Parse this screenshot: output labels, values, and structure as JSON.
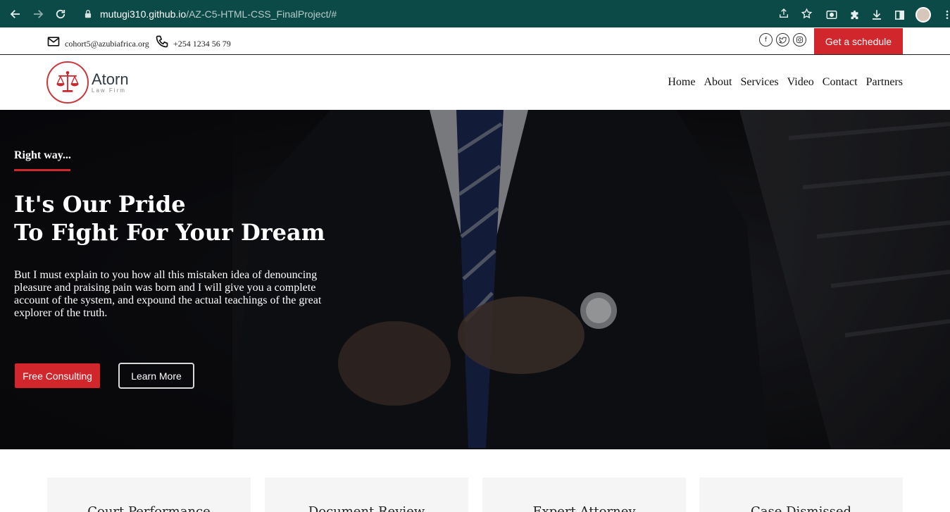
{
  "browser": {
    "url_host": "mutugi310.github.io",
    "url_path": "/AZ-C5-HTML-CSS_FinalProject/#"
  },
  "topbar": {
    "email": "cohort5@azubiafrica.org",
    "phone": "+254 1234 56 79",
    "social_icons": [
      "facebook-icon",
      "twitter-icon",
      "instagram-icon"
    ],
    "schedule_button": "Get a schedule"
  },
  "header": {
    "logo_name": "Atorn",
    "logo_sub": "Law Firm",
    "nav": [
      "Home",
      "About",
      "Services",
      "Video",
      "Contact",
      "Partners"
    ]
  },
  "hero": {
    "tag": "Right way...",
    "title_line1": "It's Our Pride",
    "title_line2": "To Fight For Your Dream",
    "text": "But I must explain to you how all this mistaken idea of denouncing pleasure and praising pain was born and I will give you a complete account of the system, and expound the actual teachings of the great explorer of the truth.",
    "btn_primary": "Free Consulting",
    "btn_secondary": "Learn More"
  },
  "cards": [
    "Court Performance",
    "Document Review",
    "Expert Attorney",
    "Case Dismissed"
  ],
  "colors": {
    "accent": "#d0262c",
    "chrome": "#0c4a48"
  }
}
